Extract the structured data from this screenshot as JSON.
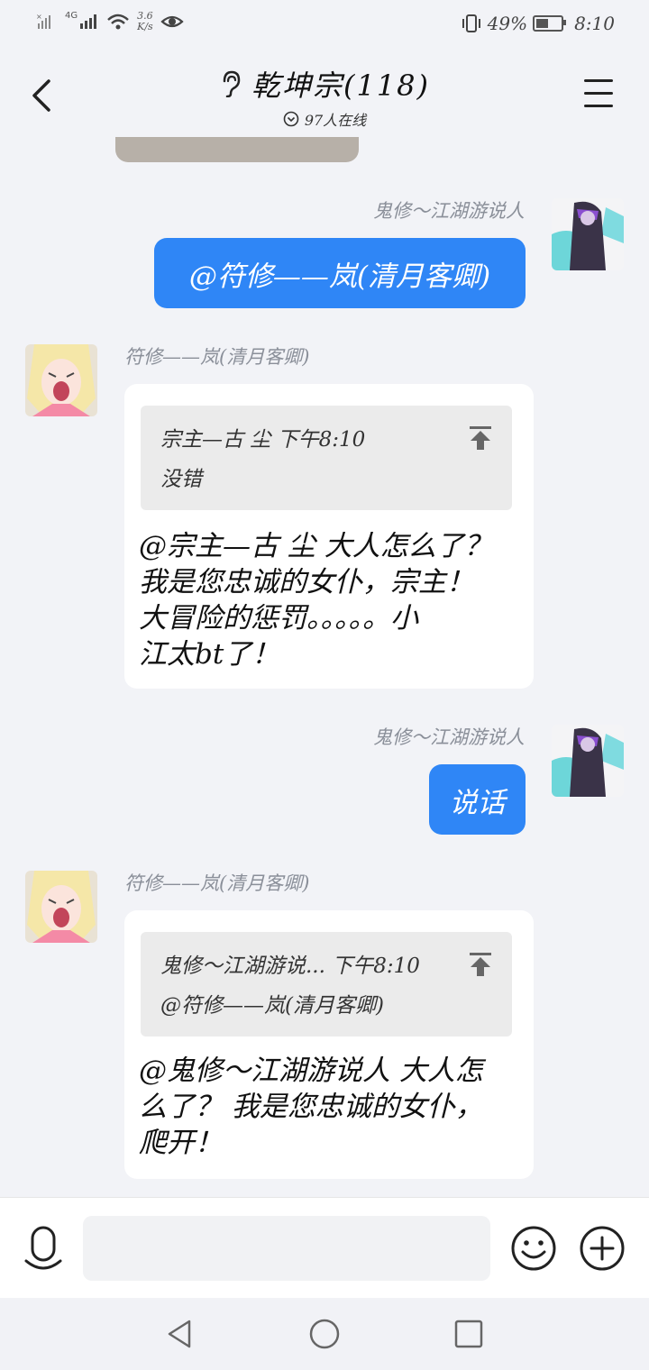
{
  "status_bar": {
    "signal_1": "4G",
    "net_speed_value": "3.6",
    "net_speed_unit": "K/s",
    "battery_percent": "49%",
    "battery_level": 0.49,
    "time": "8:10"
  },
  "header": {
    "title": "乾坤宗(118)",
    "online": "97人在线",
    "back_icon": "chevron-left-icon",
    "menu_icon": "hamburger-icon",
    "title_icon": "ear-icon"
  },
  "messages": [
    {
      "sender": "鬼修～江湖游说人",
      "side": "right",
      "text": "@符修——岚(清月客卿)"
    },
    {
      "sender": "符修——岚(清月客卿)",
      "side": "left",
      "quote_author": "宗主—古 尘",
      "quote_time": "下午8:10",
      "quote_text": "没错",
      "lines": [
        "@宗主—古 尘 大人怎么了？",
        "我是您忠诚的女仆，宗主！",
        "大冒险的惩罚。。。。。小",
        "江太bt了！"
      ]
    },
    {
      "sender": "鬼修～江湖游说人",
      "side": "right",
      "text": "说话"
    },
    {
      "sender": "符修——岚(清月客卿)",
      "side": "left",
      "quote_author": "鬼修～江湖游说...",
      "quote_time": "下午8:10",
      "quote_text": "@符修——岚(清月客卿)",
      "lines": [
        "@鬼修～江湖游说人 大人怎",
        "么了？ 我是您忠诚的女仆，",
        "爬开！"
      ]
    }
  ],
  "input": {
    "placeholder": "",
    "mic_icon": "microphone-icon",
    "emoji_icon": "smiley-icon",
    "plus_icon": "plus-circle-icon"
  },
  "colors": {
    "accent": "#2f86f6",
    "background": "#f2f3f7"
  }
}
